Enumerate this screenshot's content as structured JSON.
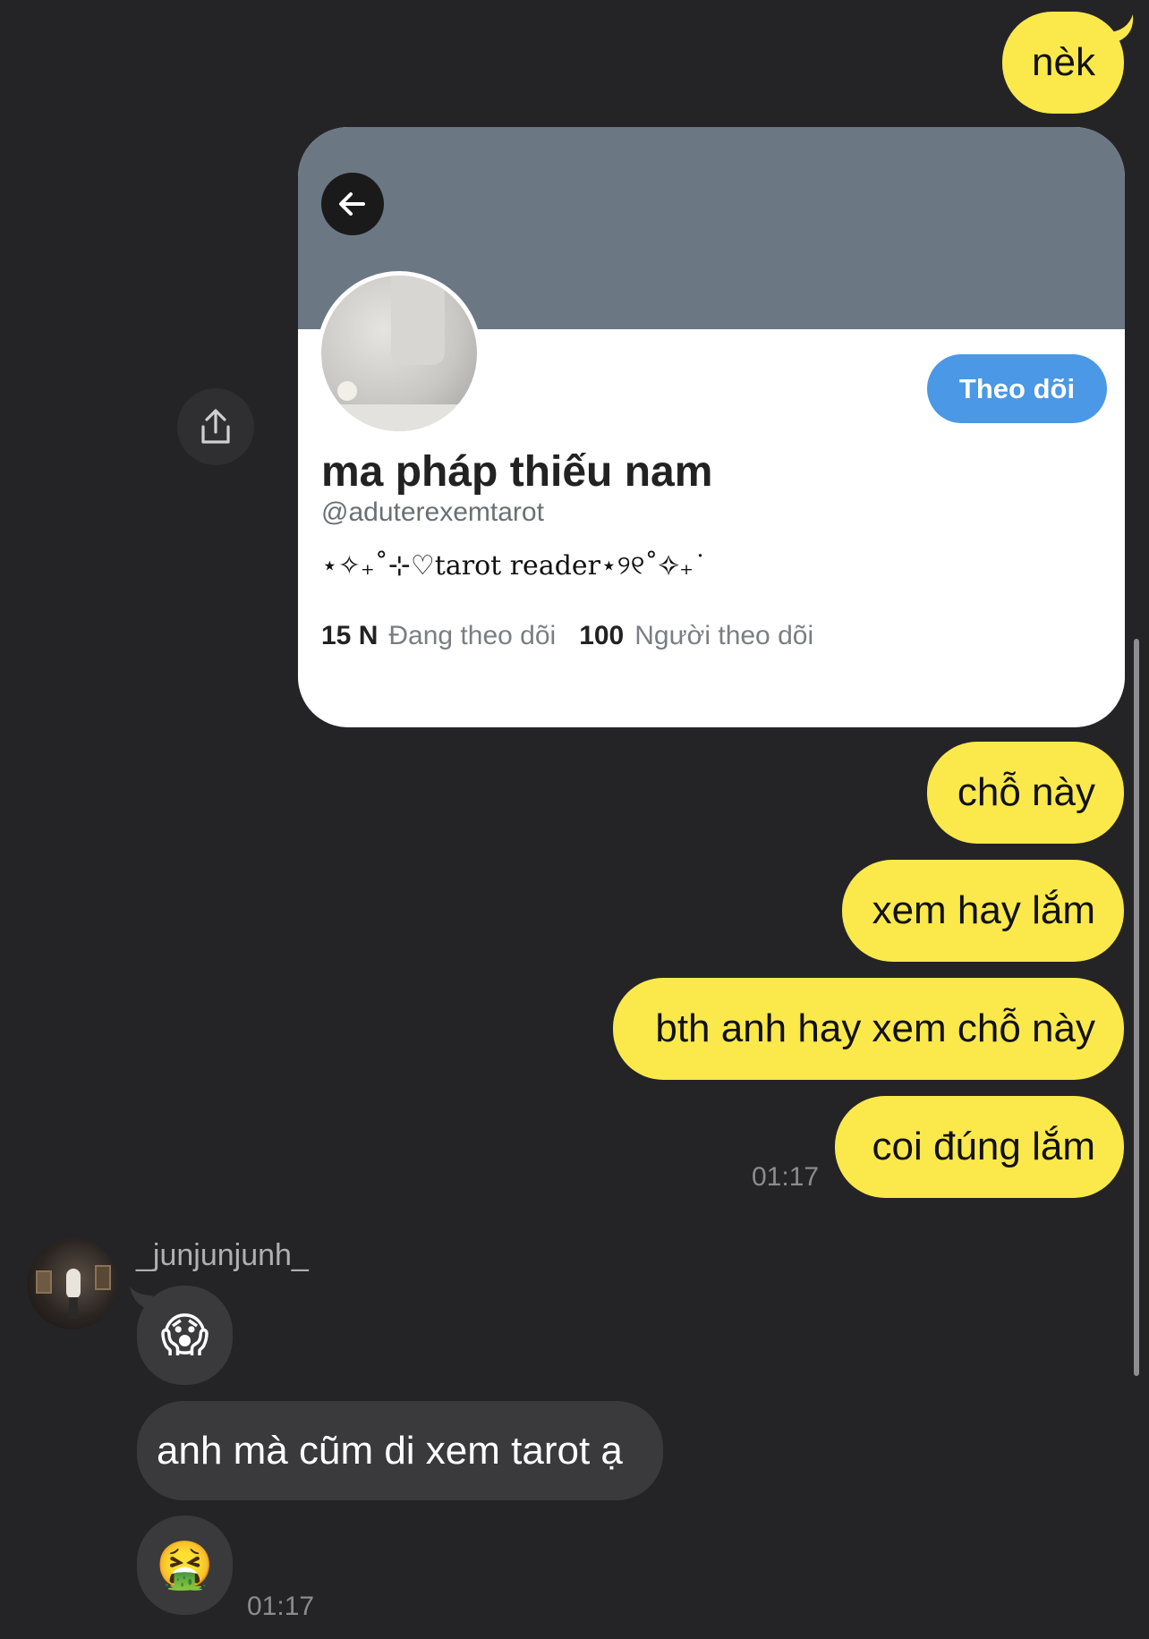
{
  "outgoing": {
    "msg1": "nèk",
    "msg2": "chỗ này",
    "msg3": "xem hay lắm",
    "msg4": "bth anh hay xem chỗ này",
    "msg5": "coi đúng lắm",
    "time": "01:17"
  },
  "shared_profile": {
    "name": "ma pháp thiếu nam",
    "handle": "@aduterexemtarot",
    "bio": "⋆✧₊˚⊹♡tarot reader⋆୨୧˚✧₊˙",
    "follow_label": "Theo dõi",
    "following_count": "15 N",
    "following_label": "Đang theo dõi",
    "followers_count": "100",
    "followers_label": "Người theo dõi"
  },
  "incoming": {
    "username": "_junjunjunh_",
    "emoji1": "😱",
    "msg": "anh mà cũm di xem tarot ạ",
    "emoji2": "🤮",
    "time": "01:17"
  },
  "icons": {
    "share": "share-icon",
    "back": "back-arrow-icon"
  },
  "colors": {
    "background": "#242427",
    "outgoing_bubble": "#fbe94b",
    "incoming_bubble": "#3a3a3d",
    "follow_button": "#4a98e6",
    "banner": "#6b7884"
  }
}
